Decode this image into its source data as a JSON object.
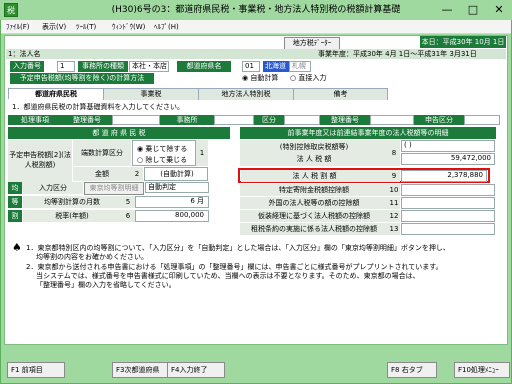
{
  "window": {
    "title": "(H30)6号の3：都道府県民税・事業税・地方法人特別税の税額計算基礎",
    "icon": "税",
    "minimize": "—",
    "maximize": "□",
    "close": "✕"
  },
  "menu": [
    "ﾌｧｲﾙ(F)",
    "表示(V)",
    "ﾂｰﾙ(T)",
    "ｳｨﾝﾄﾞｳ(W)",
    "ﾍﾙﾌﾟ(H)"
  ],
  "header": {
    "date": "本日：平成30年 10月 1日(月)",
    "tax_calc_button": "地方税ﾃﾞｰﾀｰ",
    "corp_label": "1：法人名",
    "business_year": "事業年度：平成30年 4月 1日～平成31年 3月31日"
  },
  "form": {
    "input_no_label": "入力番号",
    "input_no": "1",
    "office_type_label": "事務所の種類",
    "office_type": "本社・本店",
    "pref_label": "都道府県名",
    "pref_code": "01",
    "pref_name": "北海道",
    "pref_name2": "札幌",
    "method_label": "予定申告税額(均等割を除く)の計算方法",
    "radio_auto": "自動計算",
    "radio_direct": "直接入力"
  },
  "tabs": [
    "都道府県民税",
    "事業税",
    "地方法人特別税",
    "備考"
  ],
  "notice": "1．都道府県民税の計算基礎資料を入力してください。",
  "row1": {
    "col1": "処理事項",
    "col2": "整理番号",
    "col3": "事務所",
    "col4": "区分",
    "col5": "整理番号",
    "col6": "申告区分"
  },
  "left": {
    "header": "都 道 府 県 民 税",
    "pred_label": "予定申告税額[2](法人税割額)",
    "calc_label": "端数計算区分",
    "radio_mul": "乗じて除する",
    "radio_div": "除して乗じる",
    "amount_label": "金額",
    "amount": "(自動計算)",
    "kin_label": "均",
    "tou_label": "等",
    "wari_label": "割",
    "in_label": "入力区分",
    "in_value": "東京均等割明細",
    "auto": "自動判定",
    "months_label": "均等割計算の月数",
    "months_no": "5",
    "months": "6 月",
    "tax_label": "税率(年額)",
    "tax_no": "6",
    "tax_value": "800,000"
  },
  "right": {
    "header": "前事業年度又は前連結事業年度の法人税額等の明細",
    "r1": "(特別控除取戻税額等)",
    "r1b": "法 人 税 額",
    "r1_no": "8",
    "r1_val1": "(                     )",
    "r1_val2": "59,472,000",
    "r2": "法 人 税 割 額",
    "r2_no": "9",
    "r2_val": "2,378,880",
    "r3": "特定寄附金税額控除額",
    "r3_no": "10",
    "r4": "外国の法人税等の額の控除額",
    "r4_no": "11",
    "r5": "仮装経理に基づく法人税額の控除額",
    "r5_no": "12",
    "r6": "租税条約の実施に係る法人税額の控除額",
    "r6_no": "13"
  },
  "notes": {
    "n1": "1．東京都特別区内の均等割について、「入力区分」を「自動判定」とした場合は、「入力区分」欄の「東京均等割明細」ボタンを押し、",
    "n1b": "均等割の内容をお確かめください。",
    "n2": "2．東京都から送付される申告書における「処理事項」の「整理番号」欄には、申告書ごとに様式番号がプレプリントされています。",
    "n2b": "当システムでは、様式番号を申告書様式に印刷していため、当欄への表示は不要となります。そのため、東京都の場合は、",
    "n2c": "「整理番号」欄の入力を省略してください。"
  },
  "fkeys": [
    "F1 前項目",
    "F3次都道府県",
    "F4入力終了",
    "F8 右タブ",
    "F10処理ﾒﾆｭｰ"
  ]
}
